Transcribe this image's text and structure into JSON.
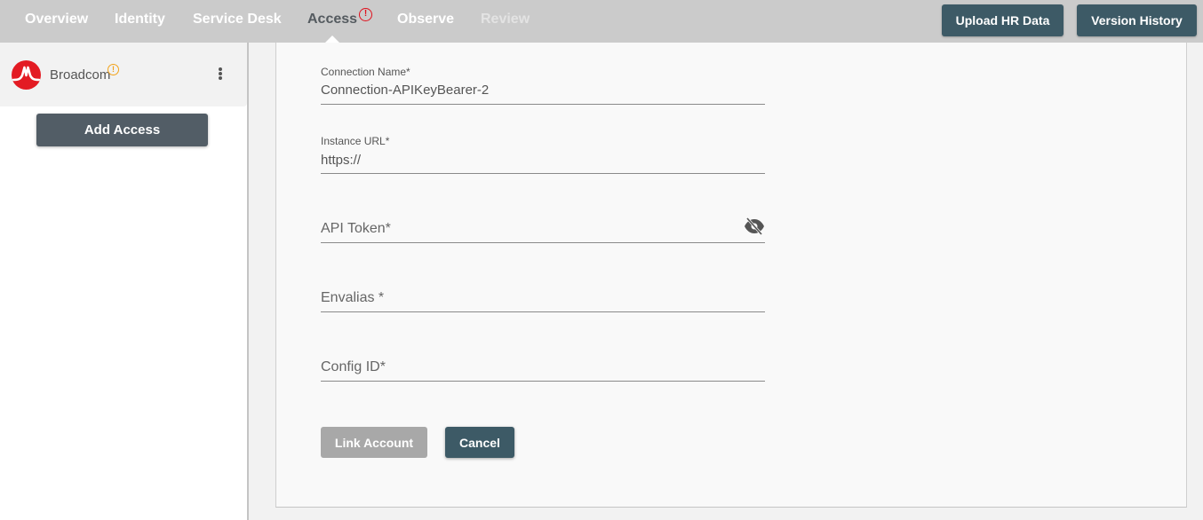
{
  "nav": {
    "tabs": [
      {
        "label": "Overview",
        "state": "normal"
      },
      {
        "label": "Identity",
        "state": "normal"
      },
      {
        "label": "Service Desk",
        "state": "normal"
      },
      {
        "label": "Access",
        "state": "active",
        "badge": "!"
      },
      {
        "label": "Observe",
        "state": "normal"
      },
      {
        "label": "Review",
        "state": "disabled"
      }
    ],
    "buttons": {
      "upload_hr_data": "Upload HR Data",
      "version_history": "Version History"
    }
  },
  "sidebar": {
    "org": {
      "name": "Broadcom",
      "warning_badge": "!",
      "logo_color": "#e31b23"
    },
    "add_access_label": "Add Access"
  },
  "form": {
    "connection_name": {
      "label": "Connection Name*",
      "value": "Connection-APIKeyBearer-2"
    },
    "instance_url": {
      "label": "Instance URL*",
      "value": "https://"
    },
    "api_token": {
      "placeholder": "API Token*",
      "value": ""
    },
    "envalias": {
      "placeholder": "Envalias *",
      "value": ""
    },
    "config_id": {
      "placeholder": "Config ID*",
      "value": ""
    },
    "link_account_label": "Link Account",
    "cancel_label": "Cancel"
  },
  "colors": {
    "primary_button": "#3d5a66",
    "alert": "#e0101c",
    "warning": "#f2a31b"
  }
}
